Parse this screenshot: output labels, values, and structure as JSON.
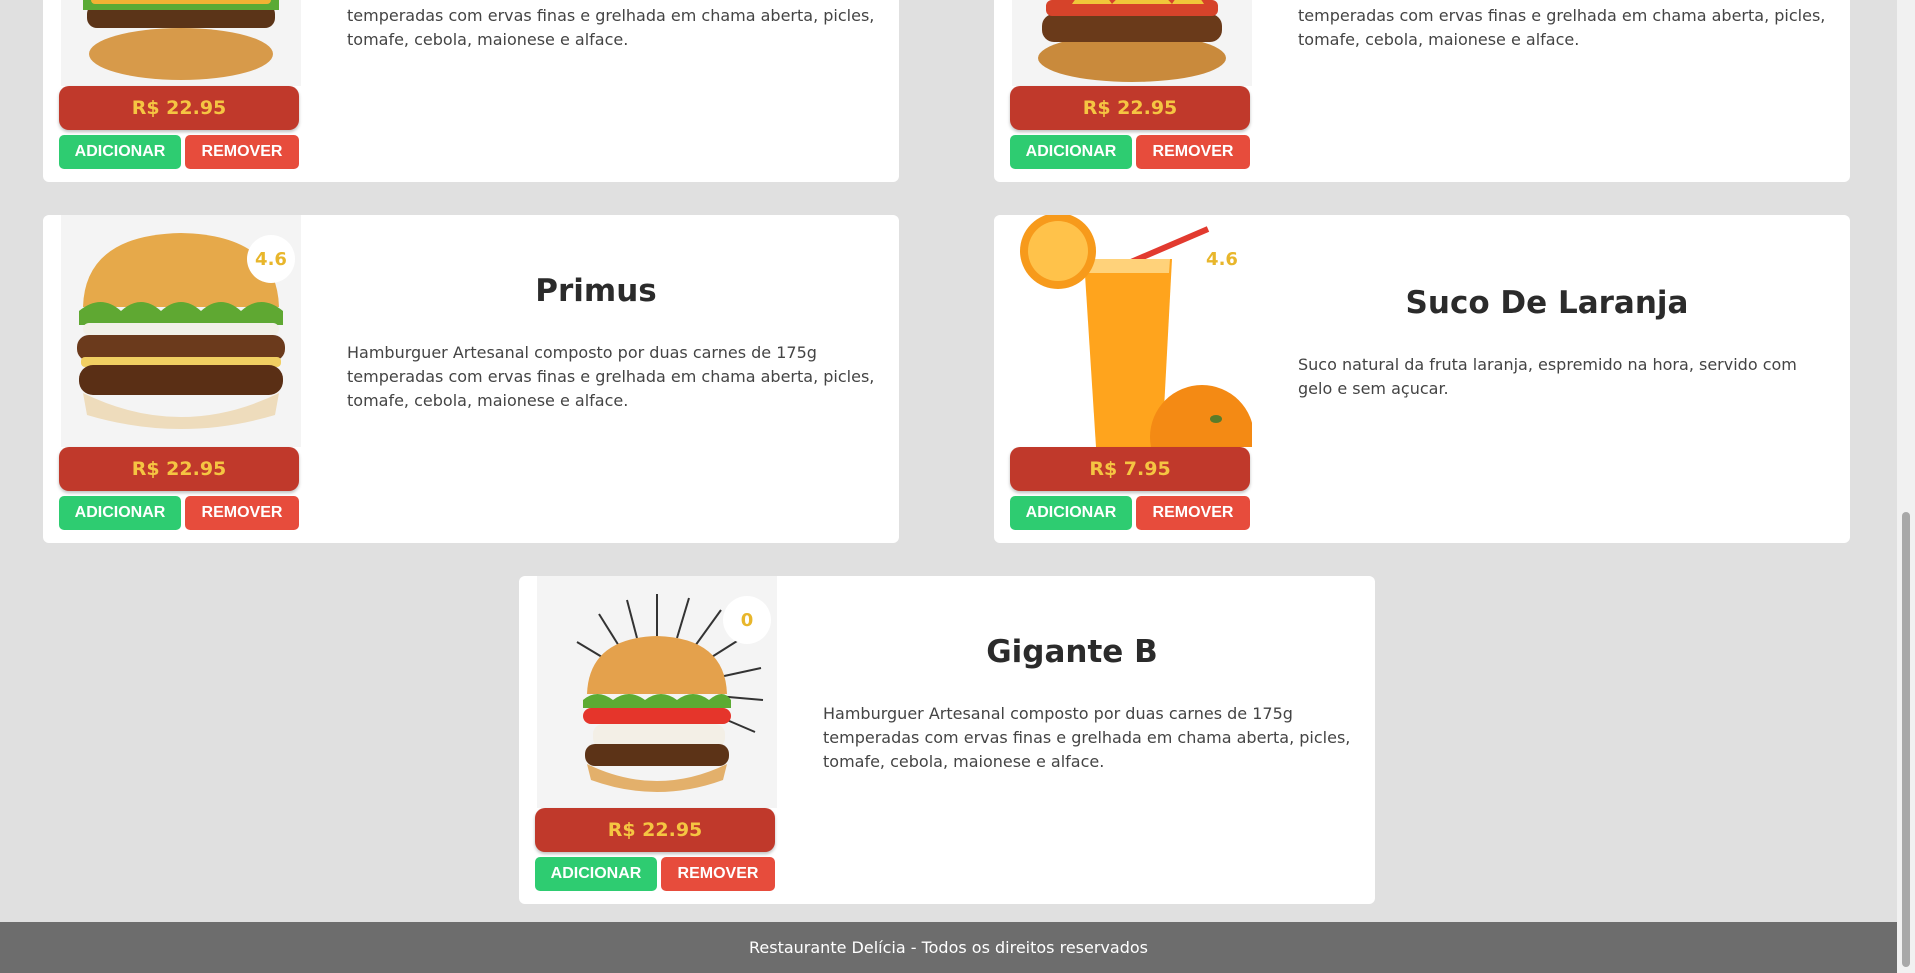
{
  "theme": {
    "page_bg": "#e0e0e0",
    "price_bg": "#c0392b",
    "price_text": "#f5c542",
    "add_button": "#2ecc71",
    "remove_button": "#e74c3c",
    "footer_bg": "#6d6d6d"
  },
  "products": [
    {
      "name": "",
      "description": "temperadas com ervas finas e grelhada em chama aberta, picles, tomafe, cebola, maionese e alface.",
      "price": "R$ 22.95",
      "add_label": "ADICIONAR",
      "remove_label": "REMOVER",
      "image_icon": "burger-icon"
    },
    {
      "name": "",
      "description": "temperadas com ervas finas e grelhada em chama aberta, picles, tomafe, cebola, maionese e alface.",
      "price": "R$ 22.95",
      "add_label": "ADICIONAR",
      "remove_label": "REMOVER",
      "image_icon": "burger-icon"
    },
    {
      "name": "Primus",
      "rating": "4.6",
      "description": "Hamburguer Artesanal composto por duas carnes de 175g temperadas com ervas finas e grelhada em chama aberta, picles, tomafe, cebola, maionese e alface.",
      "price": "R$ 22.95",
      "add_label": "ADICIONAR",
      "remove_label": "REMOVER",
      "image_icon": "burger-icon"
    },
    {
      "name": "Suco De Laranja",
      "rating": "4.6",
      "description": "Suco natural da fruta laranja, espremido na hora, servido com gelo e sem açucar.",
      "price": "R$ 7.95",
      "add_label": "ADICIONAR",
      "remove_label": "REMOVER",
      "image_icon": "orange-juice-icon"
    },
    {
      "name": "Gigante B",
      "rating": "0",
      "description": "Hamburguer Artesanal composto por duas carnes de 175g temperadas com ervas finas e grelhada em chama aberta, picles, tomafe, cebola, maionese e alface.",
      "price": "R$ 22.95",
      "add_label": "ADICIONAR",
      "remove_label": "REMOVER",
      "image_icon": "burger-icon"
    }
  ],
  "footer": {
    "text": "Restaurante Delícia - Todos os direitos reservados"
  }
}
